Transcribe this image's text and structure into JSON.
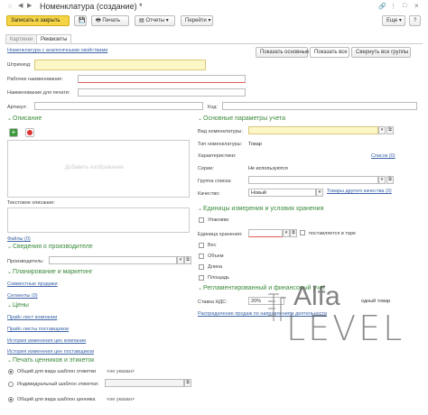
{
  "window": {
    "title": "Номенклатура (создание) *"
  },
  "toolbar": {
    "save_close": "Записать и закрыть",
    "print": "Печать",
    "reports": "Отчеты",
    "goto": "Перейти",
    "more": "Еще",
    "help": "?"
  },
  "tabs": [
    {
      "label": "Картинки"
    },
    {
      "label": "Реквизиты"
    }
  ],
  "links": {
    "analog": "Номенклатура с аналогичными свойствами"
  },
  "view_buttons": {
    "basic": "Показать основные",
    "all": "Показать все",
    "collapse": "Свернуть все группы"
  },
  "fields": {
    "barcode": "Штрихкод:",
    "work_name": "Рабочее наименование:",
    "print_name": "Наименование для печати:",
    "article": "Артикул:",
    "code": "Код:"
  },
  "description": {
    "header": "Описание",
    "placeholder": "Добавить изображение",
    "text_label": "Текстовое описание:",
    "files": "Файлы (0)"
  },
  "manufacturer": {
    "header": "Сведения о производителе",
    "label": "Производитель:"
  },
  "planning": {
    "header": "Планирование и маркетинг",
    "joint_sales": "Совместные продажи",
    "segments": "Сегменты (0)"
  },
  "prices": {
    "header": "Цены",
    "list": "Прайс-лист компании",
    "suppliers": "Прайс-листы поставщиков",
    "history": "История изменения цен компании",
    "history_suppliers": "История изменения цен поставщиков"
  },
  "labels": {
    "header": "Печать ценников и этикеток",
    "r1": "Общий для вида шаблон этикетки",
    "r1v": "<не указан>",
    "r2": "Индивидуальный шаблон этикетки:",
    "r3": "Общий для вида шаблон ценника",
    "r3v": "<не указан>"
  },
  "main_params": {
    "header": "Основные параметры учета",
    "kind": "Вид номенклатуры:",
    "type_label": "Тип номенклатуры:",
    "type_value": "Товар",
    "chars": "Характеристики:",
    "chars_link": "Список (0)",
    "series": "Серии:",
    "series_value": "Не используются",
    "group": "Группа списка:",
    "quality": "Качество:",
    "quality_value": "Новый",
    "quality_link": "Товары другого качества (0)"
  },
  "units": {
    "header": "Единицы измерения и условия хранения",
    "packs": "Упаковки",
    "storage_unit": "Единица хранения:",
    "in_pack": "поставляется в таре",
    "weight": "Вес",
    "volume": "Объем",
    "length": "Длина",
    "area": "Площадь"
  },
  "regulated": {
    "header": "Регламентированный и финансовый учет",
    "vat_label": "Ставка НДС:",
    "vat_value": "20%",
    "vat_extra": "одный товар",
    "dist": "Распределение продаж по направлениям деятельности"
  },
  "watermark": {
    "word1": "Alfa",
    "word2": "LEVEL"
  }
}
